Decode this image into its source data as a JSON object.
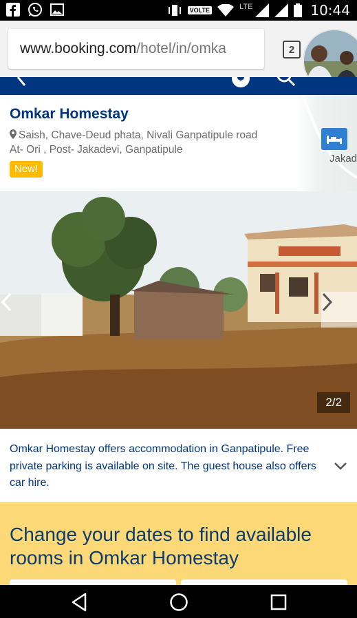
{
  "status_bar": {
    "time": "10:44",
    "network_label": "LTE",
    "volte_label": "VOLTE",
    "left_icons": [
      "facebook-icon",
      "whatsapp-icon",
      "gallery-icon"
    ],
    "right_icons": [
      "vibrate-icon",
      "wifi-icon",
      "signal-icon",
      "signal-icon",
      "battery-icon"
    ]
  },
  "browser": {
    "url_host": "www.booking.com",
    "url_path": "/hotel/in/omka",
    "tab_count": "2",
    "avatar": "profile-photo-avatar"
  },
  "hotel": {
    "name": "Omkar Homestay",
    "address_line1": "Saish, Chave-Deud phata, Nivali Ganpatipule road",
    "address_line2": "At- Ori , Post- Jakadevi, Ganpatipule",
    "badge": "New!",
    "map_label": "Jakad"
  },
  "gallery": {
    "counter": "2/2",
    "prev_icon": "chevron-left-icon",
    "next_icon": "chevron-right-icon"
  },
  "description": {
    "text": "Omkar Homestay offers accommodation in Ganpatipule. Free private parking is available on site. The guest house also offers car hire.",
    "expand_icon": "chevron-down-icon"
  },
  "availability": {
    "message": "Change your dates to find available rooms in Omkar Homestay"
  },
  "navbar": {
    "icons": [
      "back-icon",
      "home-icon",
      "recents-icon"
    ]
  },
  "colors": {
    "brand_blue": "#003580",
    "badge_yellow": "#febb02",
    "prompt_yellow": "#fcd876"
  }
}
